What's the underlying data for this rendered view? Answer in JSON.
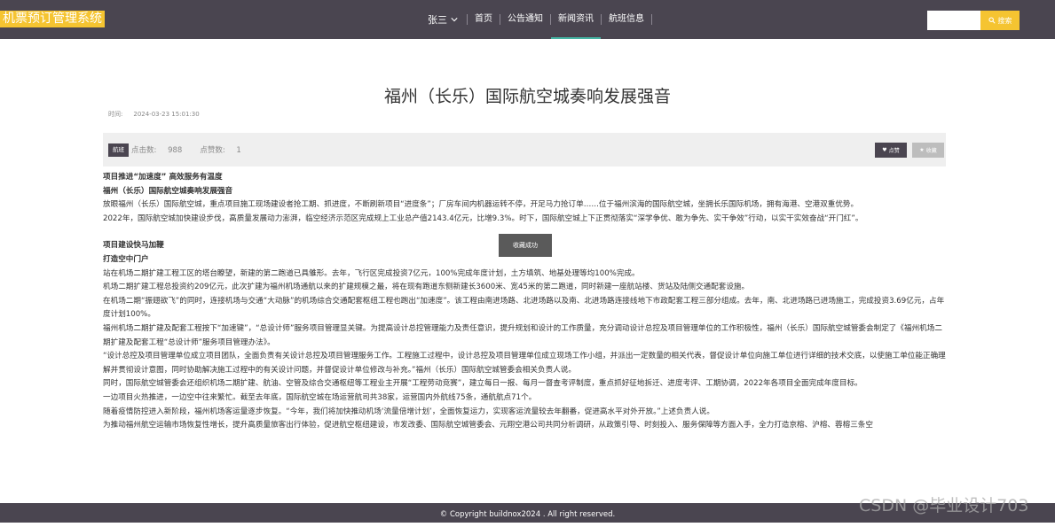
{
  "header": {
    "logo_text": "机票预订管理系统",
    "user_name": "张三",
    "nav": [
      "首页",
      "公告通知",
      "新闻资讯",
      "航班信息"
    ],
    "active_nav": "新闻资讯",
    "search": {
      "placeholder": "",
      "button_label": "搜索"
    }
  },
  "article": {
    "title": "福州（长乐）国际航空城奏响发展强音",
    "time_label": "时间:",
    "time_value": "2024-03-23 15:01:30",
    "category": "航班",
    "clicks_label": "点击数:",
    "clicks": "988",
    "likes_label": "点赞数:",
    "likes": "1",
    "like_button": "点赞",
    "fav_button": "收藏",
    "paragraphs": [
      "项目推进“加速度” 高效服务有温度",
      "福州（长乐）国际航空城奏响发展强音",
      "放眼福州（长乐）国际航空城，重点项目施工现场建设者抢工期、抓进度，不断刷新项目“进度条”；厂房车间内机器运转不停，开足马力抢订单……位于福州滨海的国际航空城，坐拥长乐国际机场，拥有海港、空港双重优势。",
      "2022年，国际航空城加快建设步伐，高质量发展动力澎湃，临空经济示范区完成规上工业总产值2143.4亿元，比增9.3%。时下，国际航空城上下正贯彻落实“深学争优、敢为争先、实干争效”行动，以实干实效奋战“开门红”。",
      "项目建设快马加鞭",
      "打造空中门户",
      "站在机场二期扩建工程工区的塔台瞭望，新建的第二跑道已具雏形。去年，飞行区完成投资7亿元，100%完成年度计划，土方填筑、地基处理等均100%完成。",
      "机场二期扩建工程总投资约209亿元，此次扩建为福州机场通航以来的扩建规模之最，将在现有跑道东侧新建长3600米、宽45米的第二跑道，同时新建一座航站楼、货站及陆侧交通配套设施。",
      "在机场二期“振翅欲飞”的同时，连接机场与交通“大动脉”的机场综合交通配套枢纽工程也跑出“加速度”。该工程由南进场路、北进场路以及南、北进场路连接线地下市政配套工程三部分组成。去年，南、北进场路已进场施工，完成投资3.69亿元，占年度计划100%。",
      "福州机场二期扩建及配套工程按下“加速键”，“总设计师”服务项目管理显关键。为提高设计总控管理能力及责任意识，提升规划和设计的工作质量，充分调动设计总控及项目管理单位的工作积极性，福州（长乐）国际航空城管委会制定了《福州机场二期扩建及配套工程“总设计师”服务项目管理办法》。",
      "“设计总控及项目管理单位成立项目团队，全面负责有关设计总控及项目管理服务工作。工程施工过程中，设计总控及项目管理单位成立现场工作小组，并派出一定数量的相关代表，督促设计单位向施工单位进行详细的技术交底，以使施工单位能正确理解并贯彻设计意图，同时协助解决施工过程中的有关设计问题，并督促设计单位修改与补充。”福州（长乐）国际航空城管委会相关负责人说。",
      "同时，国际航空城管委会还组织机场二期扩建、航油、空管及综合交通枢纽等工程业主开展“工程劳动竞赛”，建立每日一报、每月一督查考评制度，重点抓好征地拆迁、进度考评、工期协调，2022年各项目全面完成年度目标。",
      "一边项目火热推进，一边空中往来繁忙。截至去年底，国际航空城在场运营航司共38家，运营国内外航线75条，通航航点71个。",
      "随着疫情防控进入新阶段，福州机场客运量逐步恢复。“今年，我们将加快推动机场‘流量倍增计划’，全面恢复运力，实现客运流量较去年翻番，促进高水平对外开放。”上述负责人说。",
      "为推动福州航空运输市场恢复性增长，提升高质量旅客出行体验，促进航空枢纽建设，市发改委、国际航空城管委会、元翔空港公司共同分析调研，从政策引导、时刻投入、服务保障等方面入手，全力打造京榕、沪榕、蓉榕三条空"
    ]
  },
  "toast": "收藏成功",
  "footer": "© Copyright buildnox2024 . All right reserved.",
  "watermark": "CSDN @毕业设计703"
}
